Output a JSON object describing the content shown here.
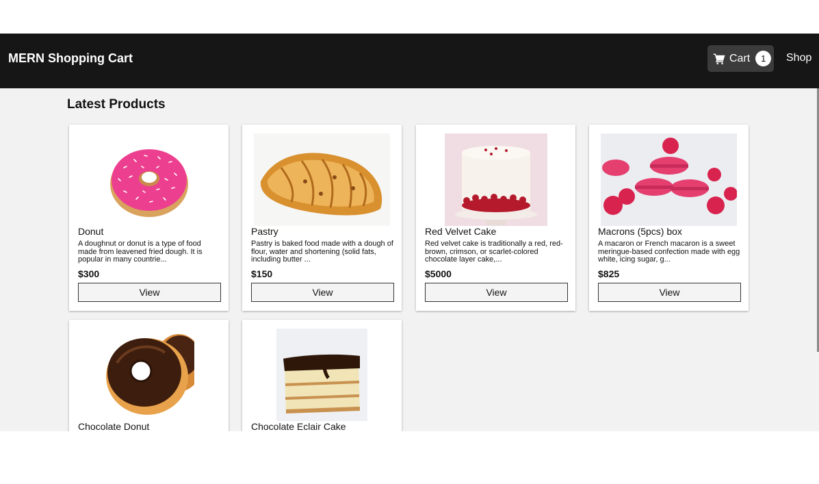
{
  "header": {
    "brand": "MERN Shopping Cart",
    "cart_label": "Cart",
    "cart_count": "1",
    "shop_label": "Shop",
    "icons": [
      "cart-icon"
    ]
  },
  "main": {
    "title": "Latest Products"
  },
  "products": [
    {
      "name": "Donut",
      "description": "A doughnut or donut is a type of food made from leavened fried dough. It is popular in many countrie...",
      "price": "$300",
      "button": "View"
    },
    {
      "name": "Pastry",
      "description": "Pastry is baked food made with a dough of flour, water and shortening (solid fats, including butter ...",
      "price": "$150",
      "button": "View"
    },
    {
      "name": "Red Velvet Cake",
      "description": "Red velvet cake is traditionally a red, red-brown, crimson, or scarlet-colored chocolate layer cake,...",
      "price": "$5000",
      "button": "View"
    },
    {
      "name": "Macrons (5pcs) box",
      "description": "A macaron or French macaron is a sweet meringue-based confection made with egg white, icing sugar, g...",
      "price": "$825",
      "button": "View"
    },
    {
      "name": "Chocolate Donut"
    },
    {
      "name": "Chocolate Eclair Cake"
    }
  ],
  "colors": {
    "navbar": "#161616",
    "page_background": "#f2f2f2",
    "card": "#ffffff"
  }
}
